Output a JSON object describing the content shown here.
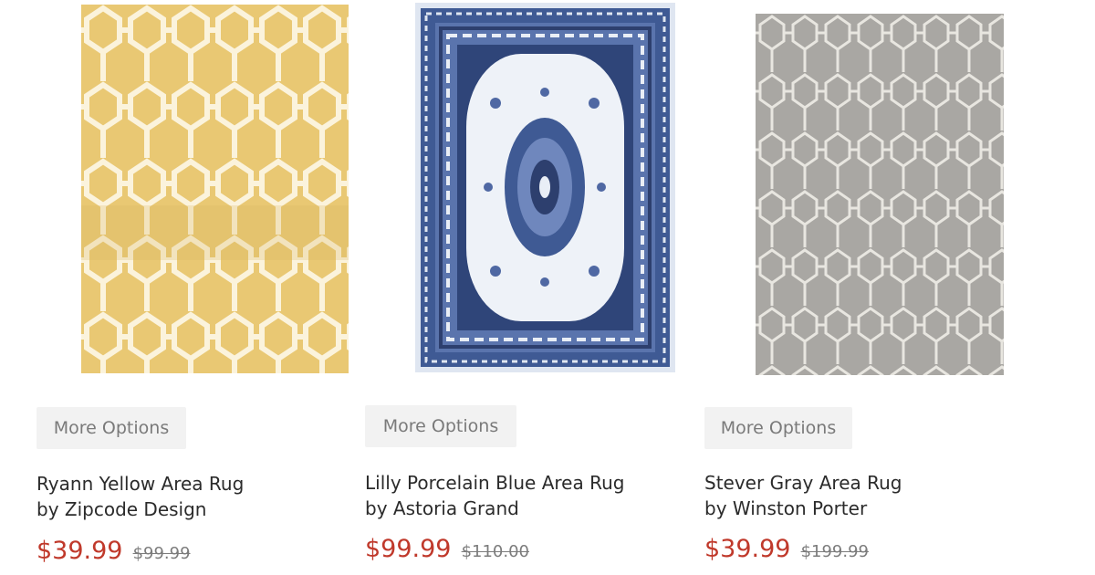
{
  "products": [
    {
      "name": "Ryann Yellow Area Rug",
      "brand": "by Zipcode Design",
      "options_label": "More Options",
      "sale_price": "$39.99",
      "original_price": "$99.99",
      "colors": {
        "base": "#e9c873",
        "pattern": "#fbf3dc"
      }
    },
    {
      "name": "Lilly Porcelain Blue Area Rug",
      "brand": "by Astoria Grand",
      "options_label": "More Options",
      "sale_price": "$99.99",
      "original_price": "$110.00",
      "colors": {
        "base": "#e9eef6",
        "border": "#3f5a94",
        "accent": "#2d3f6e"
      }
    },
    {
      "name": "Stever Gray Area Rug",
      "brand": "by Winston Porter",
      "options_label": "More Options",
      "sale_price": "$39.99",
      "original_price": "$199.99",
      "colors": {
        "base": "#a9a7a3",
        "pattern": "#e8e6e0"
      }
    }
  ],
  "colors": {
    "sale": "#c0392b",
    "button_bg": "#f2f2f2"
  }
}
